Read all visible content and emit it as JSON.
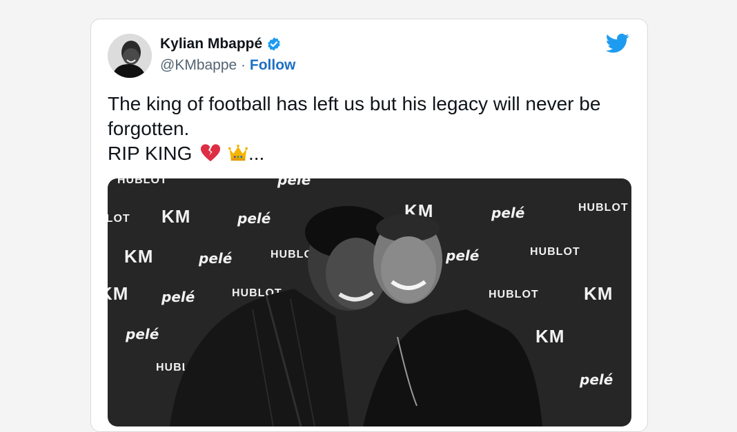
{
  "tweet": {
    "author_name": "Kylian Mbappé",
    "handle": "@KMbappe",
    "separator": " · ",
    "follow_label": "Follow",
    "text_line1": "The king of football has left us but his legacy will never be",
    "text_line2": "forgotten.",
    "text_line3": "RIP KING",
    "text_suffix": "..."
  },
  "backdrop": {
    "km": "KM",
    "pele": "pelé",
    "hublot": "HUBLOT"
  },
  "colors": {
    "link_blue": "#1d6fc4",
    "twitter_blue": "#1d9bf0",
    "verified_blue": "#1d9bf0"
  },
  "icons": [
    "verified-badge-icon",
    "twitter-bird-icon",
    "broken-heart-icon",
    "crown-icon"
  ]
}
